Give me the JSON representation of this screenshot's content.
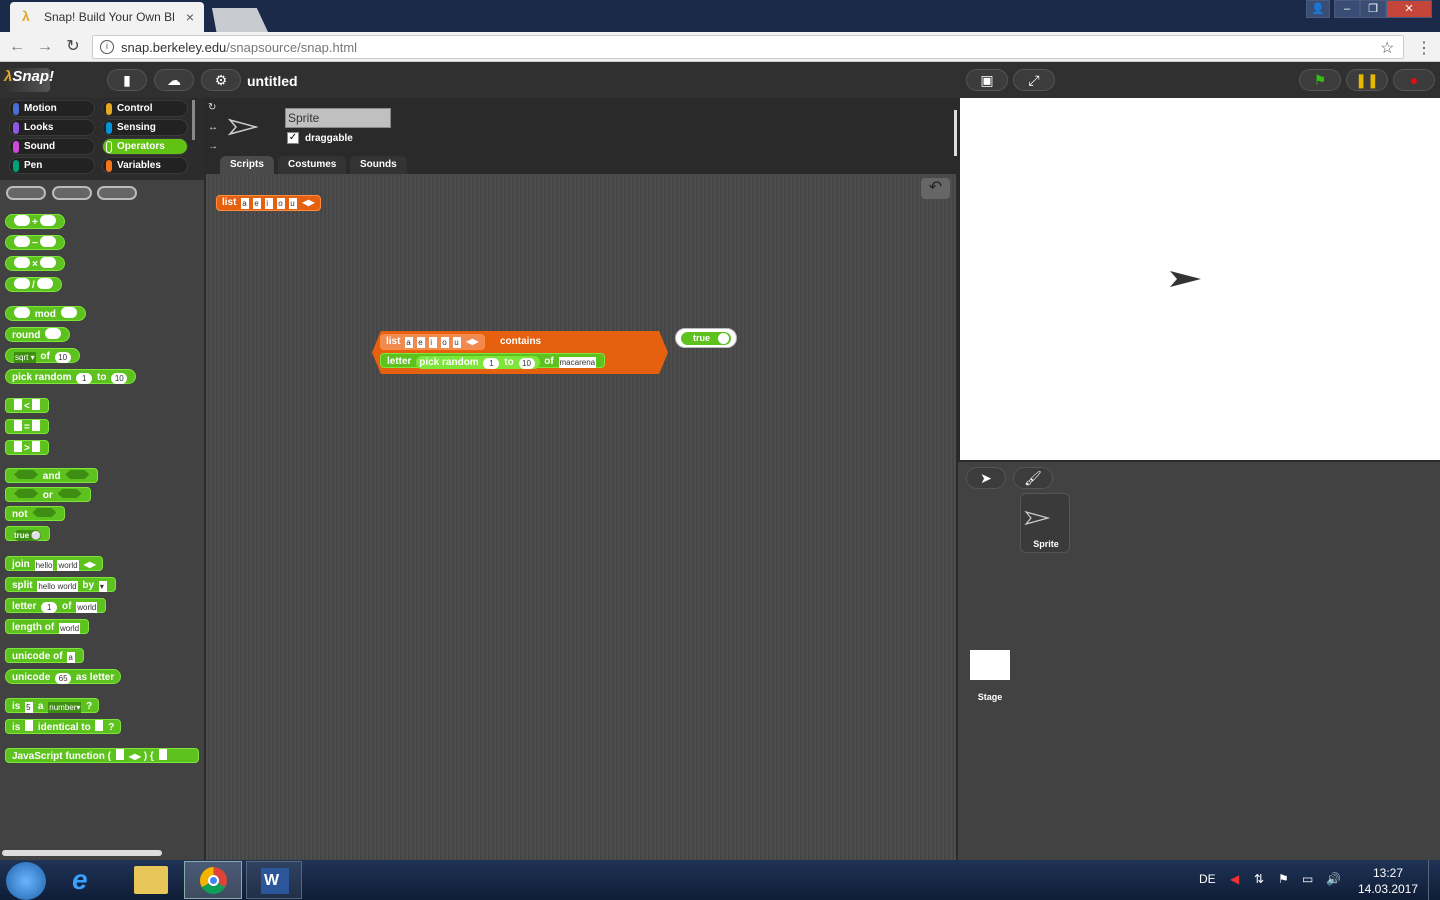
{
  "browser": {
    "tab_title": "Snap! Build Your Own Bl",
    "tab_close": "×",
    "url_prefix": "snap.berkeley.edu",
    "url_path": "/snapsource/snap.html",
    "icons": {
      "back": "back-arrow-icon",
      "forward": "forward-arrow-icon",
      "reload": "reload-icon",
      "info": "info-icon",
      "star": "star-icon",
      "menu": "kebab-menu-icon"
    }
  },
  "snap": {
    "logo": "Snap!",
    "project_title": "untitled",
    "categories": [
      {
        "label": "Motion",
        "color": "#4a6cd4"
      },
      {
        "label": "Control",
        "color": "#e6a822"
      },
      {
        "label": "Looks",
        "color": "#8f56e3"
      },
      {
        "label": "Sensing",
        "color": "#0494dc"
      },
      {
        "label": "Sound",
        "color": "#cf4ad9"
      },
      {
        "label": "Operators",
        "color": "#62c213"
      },
      {
        "label": "Pen",
        "color": "#00a178"
      },
      {
        "label": "Variables",
        "color": "#f3761d"
      }
    ],
    "palette_blocks": {
      "plus": "+",
      "minus": "−",
      "times": "×",
      "divide": "/",
      "mod": "mod",
      "round": "round",
      "sqrt": "sqrt",
      "of": "of",
      "sqrt_value": "10",
      "pick_random": "pick random",
      "pick_from": "1",
      "pick_to_label": "to",
      "pick_to": "10",
      "lt": "<",
      "eq": "=",
      "gt": ">",
      "and": "and",
      "or": "or",
      "not": "not",
      "true": "true",
      "join": "join",
      "join_a": "hello ",
      "join_b": "world",
      "split": "split",
      "split_text": "hello world",
      "split_by": "by",
      "letter": "letter",
      "letter_index": "1",
      "letter_of": "of",
      "letter_word": "world",
      "length_of": "length of",
      "length_word": "world",
      "unicode_of": "unicode of",
      "unicode_char": "a",
      "unicode": "unicode",
      "unicode_num": "65",
      "as_letter": "as letter",
      "is": "is",
      "is_value": "5",
      "is_a": "a",
      "is_type": "number",
      "q": "?",
      "identical_to": "identical to",
      "js_function": "JavaScript function ("
    },
    "sprite": {
      "name": "Sprite",
      "draggable_label": "draggable"
    },
    "tabs": [
      "Scripts",
      "Costumes",
      "Sounds"
    ],
    "script": {
      "list_label": "list",
      "list_items": [
        "a",
        "e",
        "i",
        "o",
        "u"
      ],
      "contains": "contains",
      "letter": "letter",
      "pick_random": "pick random",
      "from": "1",
      "to_label": "to",
      "to": "10",
      "of": "of",
      "word": "macarena",
      "result": "true"
    },
    "corral": {
      "sprite_label": "Sprite",
      "stage_label": "Stage"
    }
  },
  "taskbar": {
    "lang": "DE",
    "time": "13:27",
    "date": "14.03.2017"
  }
}
